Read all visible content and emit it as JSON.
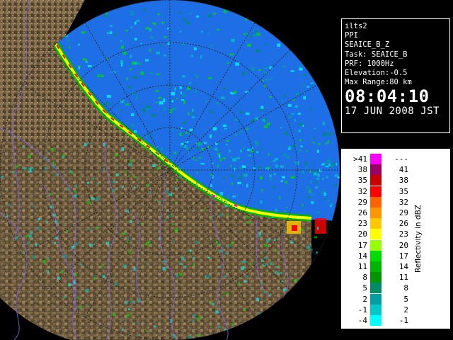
{
  "info": {
    "site": "ilts2",
    "scan_type": "PPI",
    "product": "SEAICE_B_Z",
    "task": "Task: SEAICE_B",
    "prf": "PRF: 1000Hz",
    "elevation": "Elevation:-0.5",
    "max_range": "Max Range:80 km",
    "time": "08:04:10",
    "date": "17 JUN 2008 JST"
  },
  "legend": {
    "title": "Reflectivity in dBZ",
    "rows": [
      {
        "lo": ">41",
        "hi": "---",
        "color": "#ff00ff"
      },
      {
        "lo": "38",
        "hi": "41",
        "color": "#9b0064"
      },
      {
        "lo": "35",
        "hi": "38",
        "color": "#c80000"
      },
      {
        "lo": "32",
        "hi": "35",
        "color": "#ff0000"
      },
      {
        "lo": "29",
        "hi": "32",
        "color": "#ff6400"
      },
      {
        "lo": "26",
        "hi": "29",
        "color": "#ff9600"
      },
      {
        "lo": "23",
        "hi": "26",
        "color": "#ffc800"
      },
      {
        "lo": "20",
        "hi": "23",
        "color": "#ffff00"
      },
      {
        "lo": "17",
        "hi": "20",
        "color": "#96ff00"
      },
      {
        "lo": "14",
        "hi": "17",
        "color": "#00dc00"
      },
      {
        "lo": "11",
        "hi": "14",
        "color": "#00b400"
      },
      {
        "lo": "8",
        "hi": "11",
        "color": "#009600"
      },
      {
        "lo": "5",
        "hi": "8",
        "color": "#008c64"
      },
      {
        "lo": "2",
        "hi": "5",
        "color": "#00a0a0"
      },
      {
        "lo": "-1",
        "hi": "2",
        "color": "#00c8c8"
      },
      {
        "lo": "-4",
        "hi": "-1",
        "color": "#00ffff"
      }
    ]
  },
  "colors": {
    "sea": "#1e6ee6",
    "land_dark": "#5a4a32",
    "land_light": "#a8906a",
    "rivers": "#7a64d8",
    "rings": "#222222"
  }
}
